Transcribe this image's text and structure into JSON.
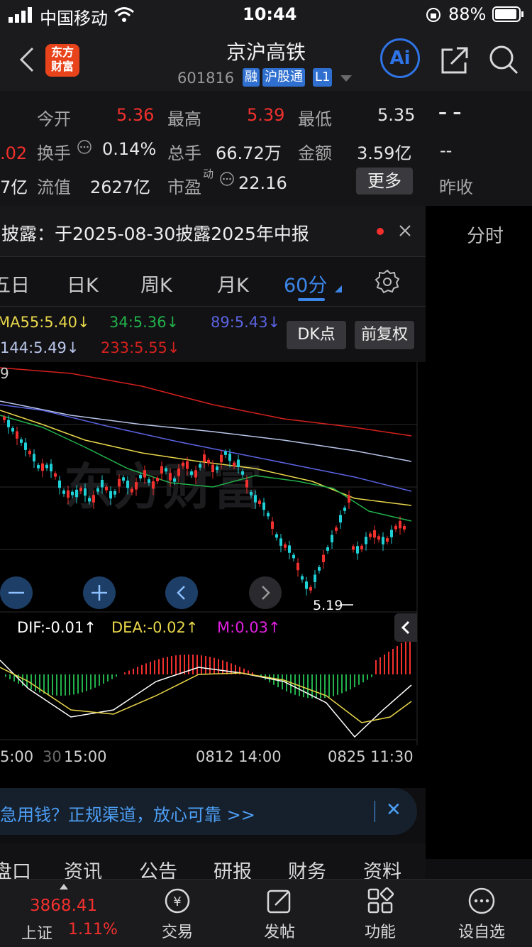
{
  "status_bar": {
    "carrier": "中国移动",
    "time": "10:44",
    "battery": "88%"
  },
  "nav": {
    "brand_line1": "东方",
    "brand_line2": "财富",
    "title": "京沪高铁",
    "code": "601816",
    "tags": [
      "融",
      "沪股通",
      "L1"
    ],
    "ai_label": "Ai"
  },
  "quote": {
    "open_label": "今开",
    "open": "5.36",
    "high_label": "最高",
    "high": "5.39",
    "low_label": "最低",
    "low": "5.35",
    "price_placeholder": "– –",
    "left_cut_1": ".02",
    "left_cut_2": "7亿",
    "turnover_label": "换手",
    "turnover": "0.14%",
    "volume_label": "总手",
    "volume": "66.72万",
    "amount_label": "金额",
    "amount": "3.59亿",
    "change_placeholder": "--",
    "float_cap_label": "流值",
    "float_cap": "2627亿",
    "pe_label": "市盈",
    "pe_sup": "动",
    "pe": "22.16",
    "more_label": "更多",
    "prev_close_label": "昨收"
  },
  "disclosure": {
    "text": "披露：于2025-08-30披露2025年中报"
  },
  "right_panel": {
    "tab_label": "分时"
  },
  "period_tabs": [
    {
      "label": "五日"
    },
    {
      "label": "日K"
    },
    {
      "label": "周K"
    },
    {
      "label": "月K"
    },
    {
      "label": "60分"
    }
  ],
  "ma_legend": {
    "ma55": "MA55:5.40↓",
    "ma34": "34:5.36↓",
    "ma89": "89:5.43↓",
    "ma144": "144:5.49↓",
    "ma233": "233:5.55↓",
    "dk_button": "DK点",
    "adjust_button": "前复权"
  },
  "chart": {
    "top_price_fragment": "9",
    "low_marker": "5.19",
    "macd": {
      "dif": "DIF:-0.01↑",
      "dea": "DEA:-0.02↑",
      "m": "M:0.03↑"
    },
    "x_labels": [
      "5:00",
      "30",
      "15:00",
      "0812 14:00",
      "0825 11:30"
    ],
    "watermark": "东方财富"
  },
  "chart_data": {
    "type": "candlestick",
    "x": [
      "0812 14:00",
      "0825 11:30"
    ],
    "series": [
      {
        "name": "MA55",
        "value": 5.4
      },
      {
        "name": "34",
        "value": 5.36
      },
      {
        "name": "89",
        "value": 5.43
      },
      {
        "name": "144",
        "value": 5.49
      },
      {
        "name": "233",
        "value": 5.55
      }
    ],
    "annotations": [
      "5.19"
    ],
    "macd": {
      "DIF": -0.01,
      "DEA": -0.02,
      "M": 0.03
    }
  },
  "ad": {
    "text": "急用钱？正规渠道，放心可靠 >>"
  },
  "content_tabs": [
    "盘口",
    "资讯",
    "公告",
    "研报",
    "财务",
    "资料"
  ],
  "toolbar": {
    "index_value": "3868.41",
    "index_name": "上证",
    "index_change": "1.11%",
    "items": [
      "交易",
      "发帖",
      "功能",
      "设自选"
    ]
  },
  "colors": {
    "up": "#f2302d",
    "down": "#1fd1d6",
    "accent": "#3c86ea",
    "ma34": "#22b04a",
    "ma55": "#e8d64a",
    "ma89": "#5a63e0",
    "ma144": "#b8c4e8",
    "ma233": "#d4211e"
  }
}
